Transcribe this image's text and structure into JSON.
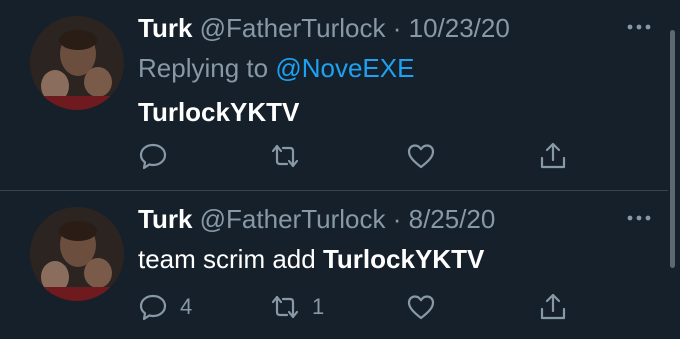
{
  "colors": {
    "background": "#15202b",
    "link": "#1da1f2",
    "muted": "#8899a6",
    "divider": "#38444d"
  },
  "icons": {
    "reply": "reply-icon",
    "retweet": "retweet-icon",
    "like": "heart-icon",
    "share": "share-icon",
    "more": "more-icon"
  },
  "tweets": [
    {
      "name": "Turk",
      "handle": "@FatherTurlock",
      "separator": "·",
      "date": "10/23/20",
      "replying_prefix": "Replying to",
      "replying_to": "@NoveEXE",
      "text": "TurlockYKTV",
      "reply_count": "",
      "retweet_count": "",
      "like_count": ""
    },
    {
      "name": "Turk",
      "handle": "@FatherTurlock",
      "separator": "·",
      "date": "8/25/20",
      "text_prefix": "team scrim add",
      "text_bold": "TurlockYKTV",
      "reply_count": "4",
      "retweet_count": "1",
      "like_count": ""
    }
  ]
}
